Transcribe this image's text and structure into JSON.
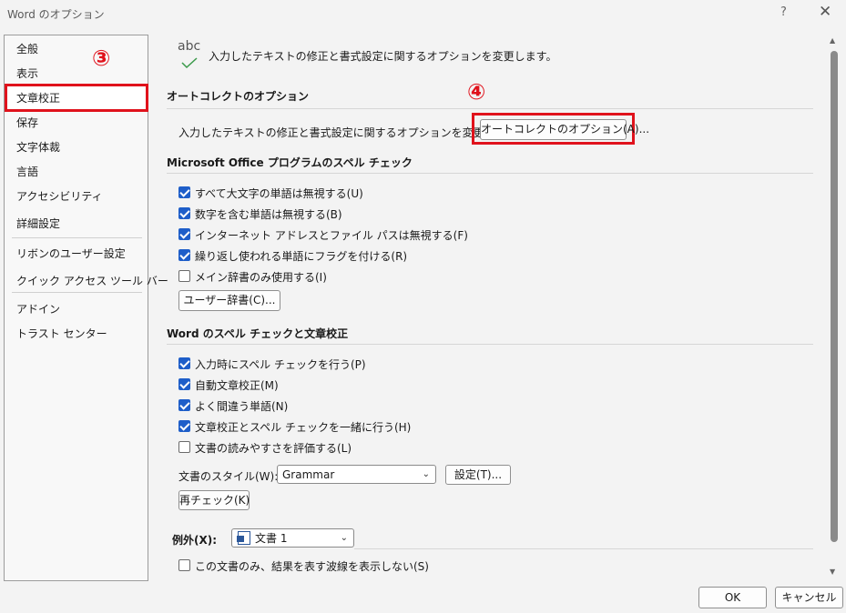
{
  "window": {
    "title": "Word のオプション",
    "help": "?",
    "close": "✕"
  },
  "nav": {
    "items": [
      "全般",
      "表示",
      "文章校正",
      "保存",
      "文字体裁",
      "言語",
      "アクセシビリティ",
      "詳細設定",
      "リボンのユーザー設定",
      "クイック アクセス ツール バー",
      "アドイン",
      "トラスト センター"
    ],
    "selected": "文章校正"
  },
  "callouts": {
    "nav": "③",
    "autocorrect": "④"
  },
  "header": {
    "abc": "abc",
    "description": "入力したテキストの修正と書式設定に関するオプションを変更します。"
  },
  "autocorrect": {
    "title": "オートコレクトのオプション",
    "description": "入力したテキストの修正と書式設定に関するオプションを変更します。",
    "button": "オートコレクトのオプション(A)..."
  },
  "office_spell": {
    "title": "Microsoft Office プログラムのスペル チェック",
    "options": [
      {
        "label": "すべて大文字の単語は無視する(U)",
        "checked": true
      },
      {
        "label": "数字を含む単語は無視する(B)",
        "checked": true
      },
      {
        "label": "インターネット アドレスとファイル パスは無視する(F)",
        "checked": true
      },
      {
        "label": "繰り返し使われる単語にフラグを付ける(R)",
        "checked": true
      },
      {
        "label": "メイン辞書のみ使用する(I)",
        "checked": false
      }
    ],
    "dict_button": "ユーザー辞書(C)..."
  },
  "word_spell": {
    "title": "Word のスペル チェックと文章校正",
    "options": [
      {
        "label": "入力時にスペル チェックを行う(P)",
        "checked": true
      },
      {
        "label": "自動文章校正(M)",
        "checked": true
      },
      {
        "label": "よく間違う単語(N)",
        "checked": true
      },
      {
        "label": "文章校正とスペル チェックを一緒に行う(H)",
        "checked": true
      },
      {
        "label": "文書の読みやすさを評価する(L)",
        "checked": false
      }
    ],
    "style_label": "文書のスタイル(W):",
    "style_value": "Grammar",
    "settings_button": "設定(T)...",
    "recheck_button": "再チェック(K)"
  },
  "exceptions": {
    "label": "例外(X):",
    "doc_value": "文書 1",
    "options": [
      {
        "label": "この文書のみ、結果を表す波線を表示しない(S)",
        "checked": false
      }
    ]
  },
  "footer": {
    "ok": "OK",
    "cancel": "キャンセル"
  },
  "colors": {
    "highlight": "#e0121c",
    "checkbox": "#1e5ec9"
  }
}
